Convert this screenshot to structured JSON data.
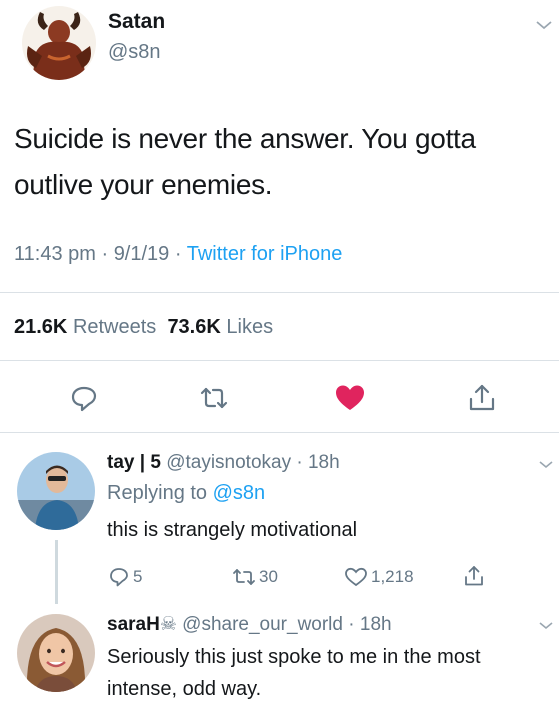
{
  "tweet": {
    "display_name": "Satan",
    "handle": "@s8n",
    "text": "Suicide is never the answer. You gotta outlive your enemies.",
    "time": "11:43 pm",
    "date": "9/1/19",
    "source": "Twitter for iPhone",
    "separator": " · ",
    "retweets_count": "21.6K",
    "retweets_label": "Retweets",
    "likes_count": "73.6K",
    "likes_label": "Likes",
    "liked": true,
    "like_color": "#e0245e",
    "icons": [
      "reply-icon",
      "retweet-icon",
      "heart-icon",
      "share-icon",
      "chevron-down-icon"
    ]
  },
  "replies": [
    {
      "display_name": "tay | 5",
      "handle": "@tayisnotokay",
      "time": "18h",
      "replying_prefix": "Replying to",
      "replying_to": "@s8n",
      "text": "this is strangely motivational",
      "reply_count": "5",
      "retweet_count": "30",
      "like_count": "1,218"
    },
    {
      "display_name": "saraH",
      "name_emoji": "☠",
      "handle": "@share_our_world",
      "time": "18h",
      "text": "Seriously this just spoke to me in the most intense, odd way."
    }
  ],
  "colors": {
    "text": "#14171a",
    "secondary": "#657786",
    "link": "#1da1f2",
    "divider": "#dbe1e6"
  }
}
